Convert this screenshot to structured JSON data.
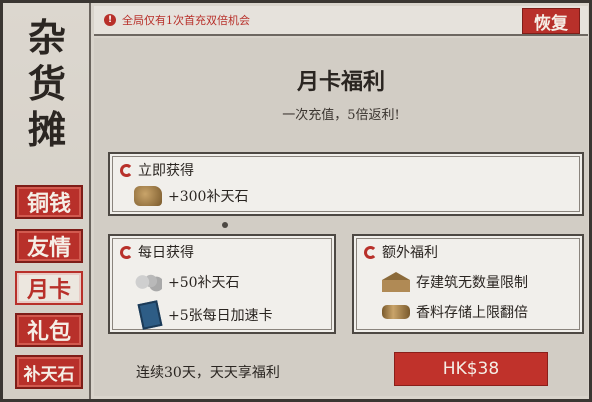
{
  "sidebar": {
    "title_chars": [
      "杂",
      "货",
      "摊"
    ],
    "items": [
      {
        "label": "铜钱",
        "active": false
      },
      {
        "label": "友情",
        "active": false
      },
      {
        "label": "月卡",
        "active": true
      },
      {
        "label": "礼包",
        "active": false
      },
      {
        "label": "补天石",
        "active": false
      }
    ]
  },
  "notice": {
    "icon": "!",
    "text": "全局仅有1次首充双倍机会",
    "restore_label": "恢复"
  },
  "card": {
    "title": "月卡福利",
    "subtitle": "一次充值，5倍返利!"
  },
  "instant": {
    "heading": "立即获得",
    "rewards": [
      {
        "icon": "stone-icon",
        "text": "+300补天石"
      }
    ]
  },
  "daily": {
    "heading": "每日获得",
    "rewards": [
      {
        "icon": "coins-icon",
        "text": "+50补天石"
      },
      {
        "icon": "speedup-card-icon",
        "text": "+5张每日加速卡"
      }
    ]
  },
  "extra": {
    "heading": "额外福利",
    "rewards": [
      {
        "icon": "building-icon",
        "text": "存建筑无数量限制"
      },
      {
        "icon": "scroll-icon",
        "text": "香料存储上限翻倍"
      }
    ]
  },
  "footer": {
    "text": "连续30天，天天享福利",
    "price": "HK$38"
  },
  "colors": {
    "accent_red": "#b8302a",
    "paper": "#d2cdc5",
    "panel": "#f1efeb"
  }
}
